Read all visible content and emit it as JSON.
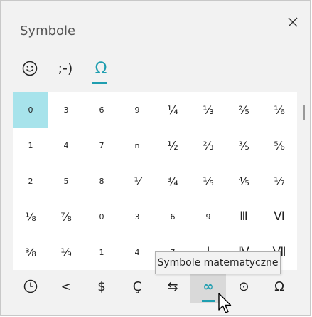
{
  "window": {
    "title": "Symbole"
  },
  "tabs": [
    {
      "name": "tab-emoji",
      "label": "☺",
      "active": false
    },
    {
      "name": "tab-kaomoji",
      "label": ";-)",
      "active": false
    },
    {
      "name": "tab-symbols",
      "label": "Ω",
      "active": true
    }
  ],
  "symbols": [
    "0",
    "3",
    "6",
    "9",
    "¼",
    "⅓",
    "⅖",
    "⅙",
    "1",
    "4",
    "7",
    "n",
    "½",
    "⅔",
    "⅗",
    "⅚",
    "2",
    "5",
    "8",
    "⅟",
    "¾",
    "⅕",
    "⅘",
    "⅐",
    "⅛",
    "⅞",
    "0",
    "3",
    "6",
    "9",
    "Ⅲ",
    "Ⅵ",
    "⅜",
    "⅑",
    "1",
    "4",
    "7",
    "Ⅰ",
    "Ⅳ",
    "Ⅶ"
  ],
  "selected_index": 0,
  "categories": [
    {
      "name": "category-recent",
      "label": "🕓",
      "icon": "clock-icon",
      "active": false
    },
    {
      "name": "category-punctuation",
      "label": "<",
      "active": false
    },
    {
      "name": "category-currency",
      "label": "$",
      "active": false
    },
    {
      "name": "category-latin",
      "label": "Ç",
      "active": false
    },
    {
      "name": "category-arrows",
      "label": "⇆",
      "active": false
    },
    {
      "name": "category-math",
      "label": "∞",
      "active": true
    },
    {
      "name": "category-geometric",
      "label": "⊙",
      "active": false
    },
    {
      "name": "category-greek",
      "label": "Ω",
      "active": false
    }
  ],
  "tooltip": "Symbole matematyczne",
  "colors": {
    "accent": "#1f9eb0",
    "selected_bg": "#a7e3eb"
  }
}
